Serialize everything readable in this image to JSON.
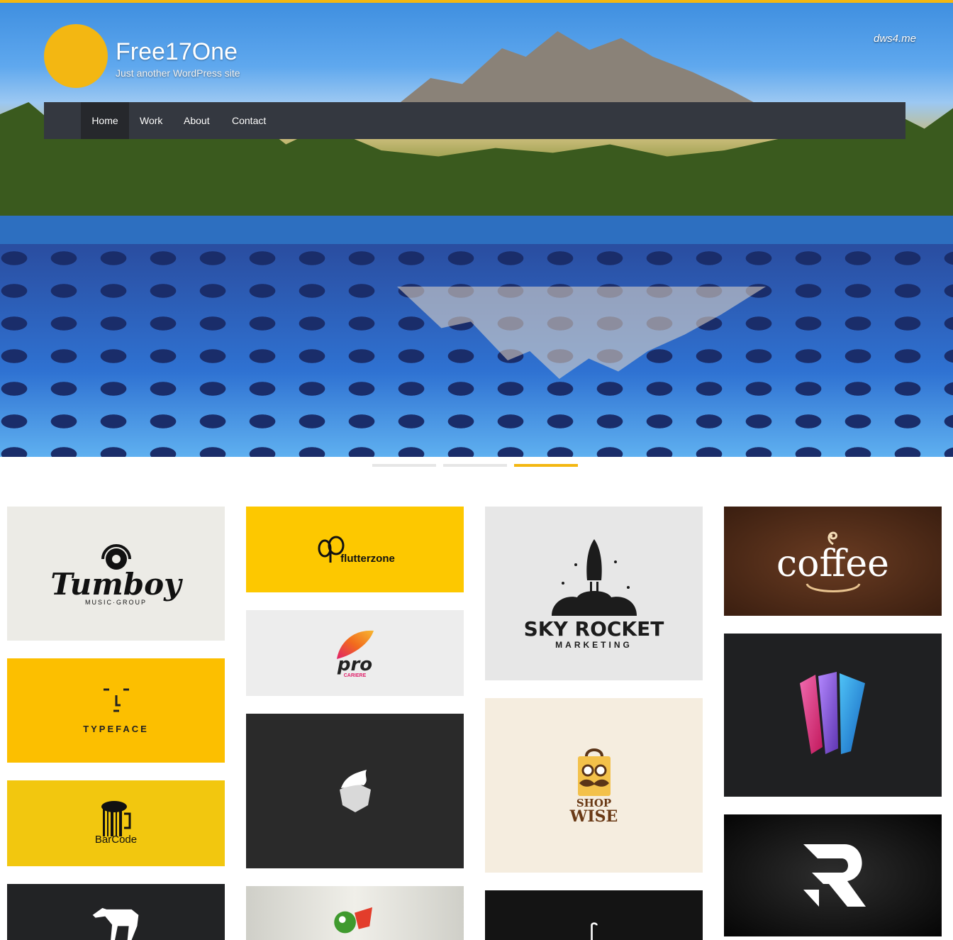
{
  "header": {
    "site_title": "Free17One",
    "tagline": "Just another WordPress site",
    "watermark": "dws4.me",
    "accent_color": "#f3b712"
  },
  "nav": {
    "items": [
      {
        "label": "Home",
        "active": true
      },
      {
        "label": "Work",
        "active": false
      },
      {
        "label": "About",
        "active": false
      },
      {
        "label": "Contact",
        "active": false
      }
    ]
  },
  "slider": {
    "dots": [
      {
        "active": false
      },
      {
        "active": false
      },
      {
        "active": true
      }
    ]
  },
  "portfolio": {
    "tumboy": {
      "name": "Tumboy",
      "sub": "MUSIC·GROUP"
    },
    "typeface": {
      "name": "TYPEFACE"
    },
    "barcode": {
      "name": "BarCode"
    },
    "flutterzone": {
      "name": "flutterzone"
    },
    "pro": {
      "name": "pro",
      "sub": "CARIERE"
    },
    "skyrocket": {
      "name": "SKY ROCKET",
      "sub": "MARKETING"
    },
    "shopwise": {
      "line1": "SHOP",
      "line2": "WISE"
    },
    "coffee": {
      "name": "coffee"
    }
  }
}
